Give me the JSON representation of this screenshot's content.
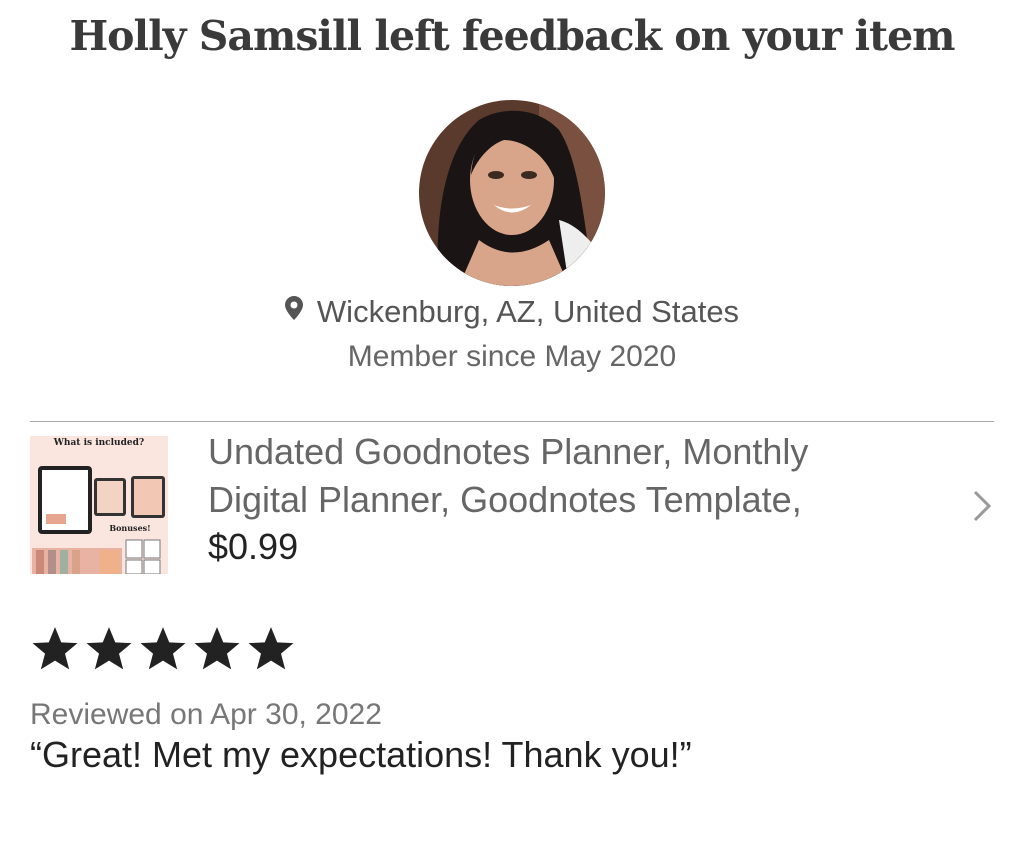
{
  "header": {
    "title": "Holly Samsill left feedback on your item"
  },
  "reviewer": {
    "avatar_icon": "profile-photo",
    "location": "Wickenburg, AZ, United States",
    "member_since": "Member since May 2020"
  },
  "listing": {
    "thumbnail_heading": "What is included?",
    "thumbnail_bonus": "Bonuses!",
    "title_line1": "Undated Goodnotes Planner, Monthly",
    "title_line2": "Digital Planner, Goodnotes Template,",
    "price": "$0.99",
    "chevron_icon": "chevron-right-icon"
  },
  "review": {
    "rating": 5,
    "max_rating": 5,
    "date": "Reviewed on Apr 30, 2022",
    "text": "“Great! Met my expectations! Thank you!”"
  }
}
